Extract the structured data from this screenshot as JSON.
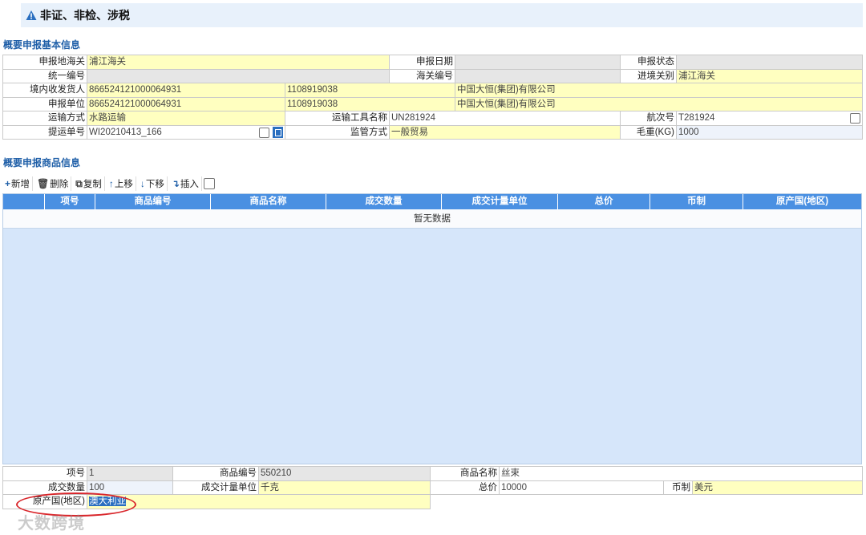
{
  "header": {
    "title": "非证、非检、涉税"
  },
  "basic_info": {
    "section_title": "概要申报基本信息",
    "declare_port_label": "申报地海关",
    "declare_port_value": "浦江海关",
    "declare_date_label": "申报日期",
    "declare_date_value": "",
    "declare_status_label": "申报状态",
    "declare_status_value": "",
    "unified_no_label": "统一编号",
    "unified_no_value": "",
    "customs_no_label": "海关编号",
    "customs_no_value": "",
    "entry_port_label": "进境关别",
    "entry_port_value": "浦江海关",
    "consignee_label": "境内收发货人",
    "consignee_code": "866524121000064931",
    "consignee_code2": "1108919038",
    "consignee_name": "中国大恒(集团)有限公司",
    "applicant_label": "申报单位",
    "applicant_code": "866524121000064931",
    "applicant_code2": "1108919038",
    "applicant_name": "中国大恒(集团)有限公司",
    "transport_mode_label": "运输方式",
    "transport_mode_value": "水路运输",
    "vehicle_name_label": "运输工具名称",
    "vehicle_name_value": "UN281924",
    "voyage_label": "航次号",
    "voyage_value": "T281924",
    "bill_no_label": "提运单号",
    "bill_no_value": "WI20210413_166",
    "supervision_label": "监管方式",
    "supervision_value": "一般贸易",
    "gross_weight_label": "毛重(KG)",
    "gross_weight_value": "1000"
  },
  "goods": {
    "section_title": "概要申报商品信息",
    "toolbar": {
      "add": "新增",
      "delete": "删除",
      "copy": "复制",
      "up": "上移",
      "down": "下移",
      "insert": "插入"
    },
    "columns": [
      "项号",
      "商品编号",
      "商品名称",
      "成交数量",
      "成交计量单位",
      "总价",
      "币制",
      "原产国(地区)"
    ],
    "empty_text": "暂无数据"
  },
  "detail": {
    "item_no_label": "项号",
    "item_no_value": "1",
    "hs_code_label": "商品编号",
    "hs_code_value": "550210",
    "goods_name_label": "商品名称",
    "goods_name_value": "丝束",
    "qty_label": "成交数量",
    "qty_value": "100",
    "unit_label": "成交计量单位",
    "unit_value": "千克",
    "total_label": "总价",
    "total_value": "10000",
    "currency_label": "币制",
    "currency_value": "美元",
    "origin_label": "原产国(地区)",
    "origin_value": "澳大利亚"
  },
  "watermark": "大数跨境",
  "colors": {
    "header_blue": "#4a90e2",
    "field_yellow": "#ffffc0",
    "annotation_red": "#d9262b"
  }
}
